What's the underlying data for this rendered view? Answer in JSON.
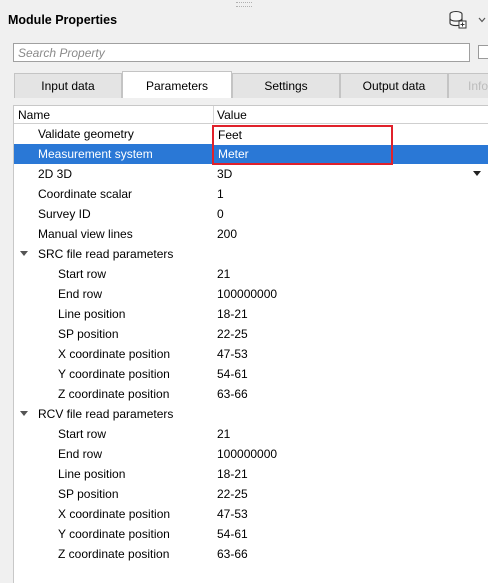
{
  "panel": {
    "title": "Module Properties"
  },
  "search": {
    "placeholder": "Search Property",
    "value": ""
  },
  "tabs": [
    {
      "label": "Input data",
      "active": false
    },
    {
      "label": "Parameters",
      "active": true
    },
    {
      "label": "Settings",
      "active": false
    },
    {
      "label": "Output data",
      "active": false
    },
    {
      "label": "Info",
      "active": false,
      "disabled": true
    }
  ],
  "grid": {
    "headers": {
      "name": "Name",
      "value": "Value"
    },
    "rows": [
      {
        "name": "Validate geometry",
        "value": "Feet",
        "indent": 1
      },
      {
        "name": "Measurement system",
        "value": "Meter",
        "indent": 1,
        "selected": true
      },
      {
        "name": "2D 3D",
        "value": "3D",
        "indent": 1,
        "combo": true
      },
      {
        "name": "Coordinate scalar",
        "value": "1",
        "indent": 1
      },
      {
        "name": "Survey ID",
        "value": "0",
        "indent": 1
      },
      {
        "name": "Manual view lines",
        "value": "200",
        "indent": 1
      },
      {
        "name": "SRC file read parameters",
        "value": "",
        "indent": 0,
        "group": true
      },
      {
        "name": "Start row",
        "value": "21",
        "indent": 2
      },
      {
        "name": "End row",
        "value": "100000000",
        "indent": 2
      },
      {
        "name": "Line position",
        "value": "18-21",
        "indent": 2
      },
      {
        "name": "SP position",
        "value": "22-25",
        "indent": 2
      },
      {
        "name": "X coordinate position",
        "value": "47-53",
        "indent": 2
      },
      {
        "name": "Y coordinate position",
        "value": "54-61",
        "indent": 2
      },
      {
        "name": "Z coordinate position",
        "value": "63-66",
        "indent": 2
      },
      {
        "name": "RCV file read parameters",
        "value": "",
        "indent": 0,
        "group": true
      },
      {
        "name": "Start row",
        "value": "21",
        "indent": 2
      },
      {
        "name": "End row",
        "value": "100000000",
        "indent": 2
      },
      {
        "name": "Line position",
        "value": "18-21",
        "indent": 2
      },
      {
        "name": "SP position",
        "value": "22-25",
        "indent": 2
      },
      {
        "name": "X coordinate position",
        "value": "47-53",
        "indent": 2
      },
      {
        "name": "Y coordinate position",
        "value": "54-61",
        "indent": 2
      },
      {
        "name": "Z coordinate position",
        "value": "63-66",
        "indent": 2
      }
    ]
  },
  "dropdown": {
    "options": [
      "Feet",
      "Meter"
    ],
    "highlighted": "Meter"
  },
  "colors": {
    "selection": "#2a78d6",
    "highlight_box": "#e0212b"
  },
  "icons": {
    "toolbar": "database-icon",
    "menu": "chevron-down-icon",
    "group_expander": "caret-down-icon"
  }
}
